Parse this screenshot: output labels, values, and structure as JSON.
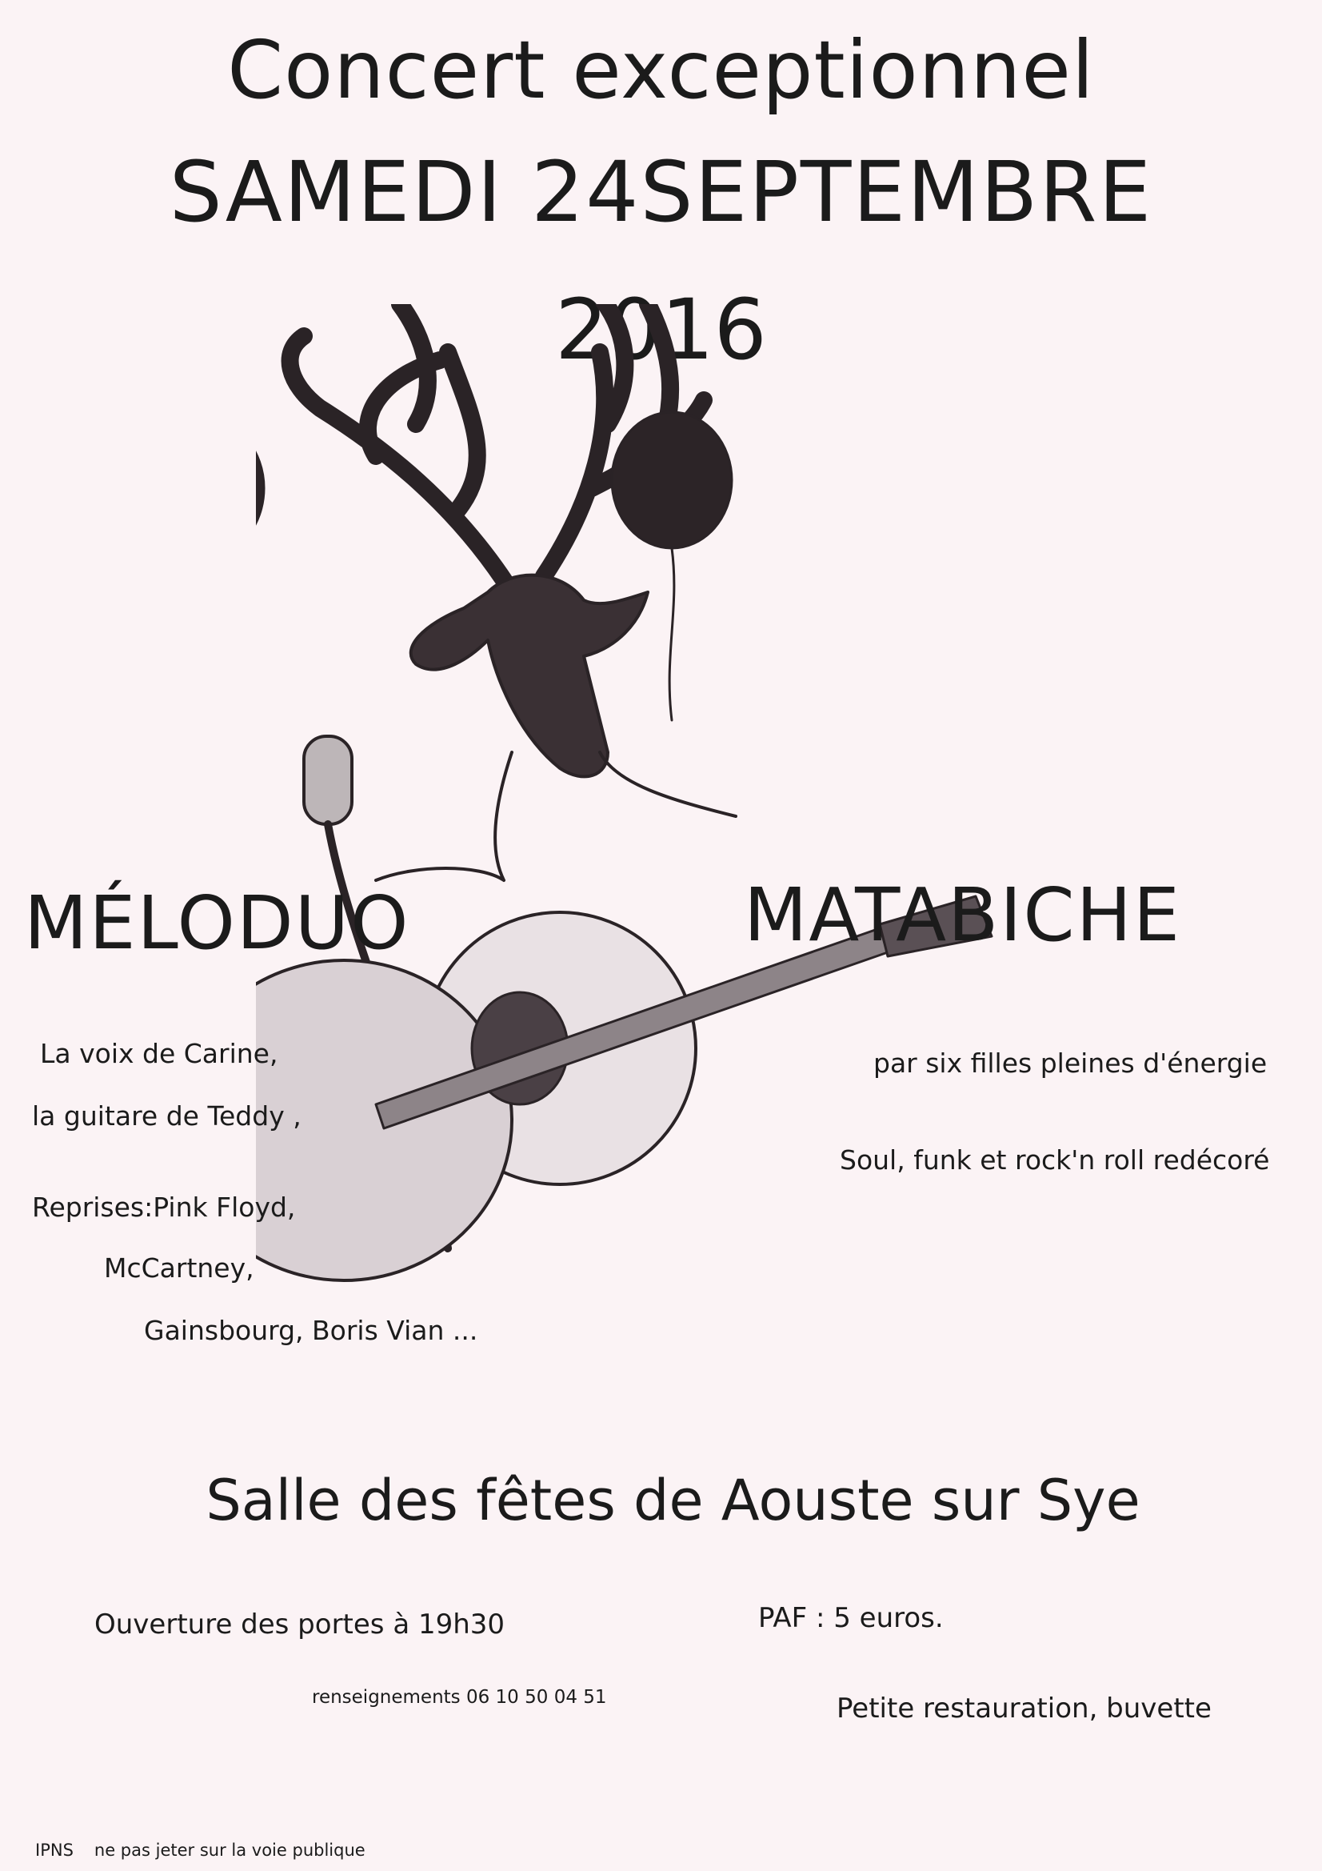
{
  "header": {
    "line1": "Concert exceptionnel",
    "line2": "SAMEDI 24SEPTEMBRE",
    "line3": "2016"
  },
  "illustration": {
    "subject": "deer-singer-with-microphone-and-guitar"
  },
  "band_left": {
    "name": "MÉLODUO",
    "lines": [
      "La voix de Carine,",
      "la guitare de Teddy ,",
      "Reprises:Pink Floyd,",
      "McCartney,",
      "Gainsbourg, Boris Vian ..."
    ]
  },
  "band_right": {
    "name": "MATABICHE",
    "lines": [
      "par six filles pleines d'énergie",
      "Soul, funk et rock'n roll redécoré"
    ]
  },
  "venue": "Salle des fêtes de Aouste sur Sye",
  "info": {
    "doors": "Ouverture des portes à 19h30",
    "price": "PAF : 5 euros.",
    "contact": "renseignements 06 10 50 04 51",
    "food": "Petite restauration, buvette"
  },
  "footer": {
    "ipns": "IPNS",
    "notice": "ne pas jeter sur la voie publique"
  },
  "colors": {
    "paper": "#fbf3f5",
    "ink": "#1b1b1b"
  }
}
